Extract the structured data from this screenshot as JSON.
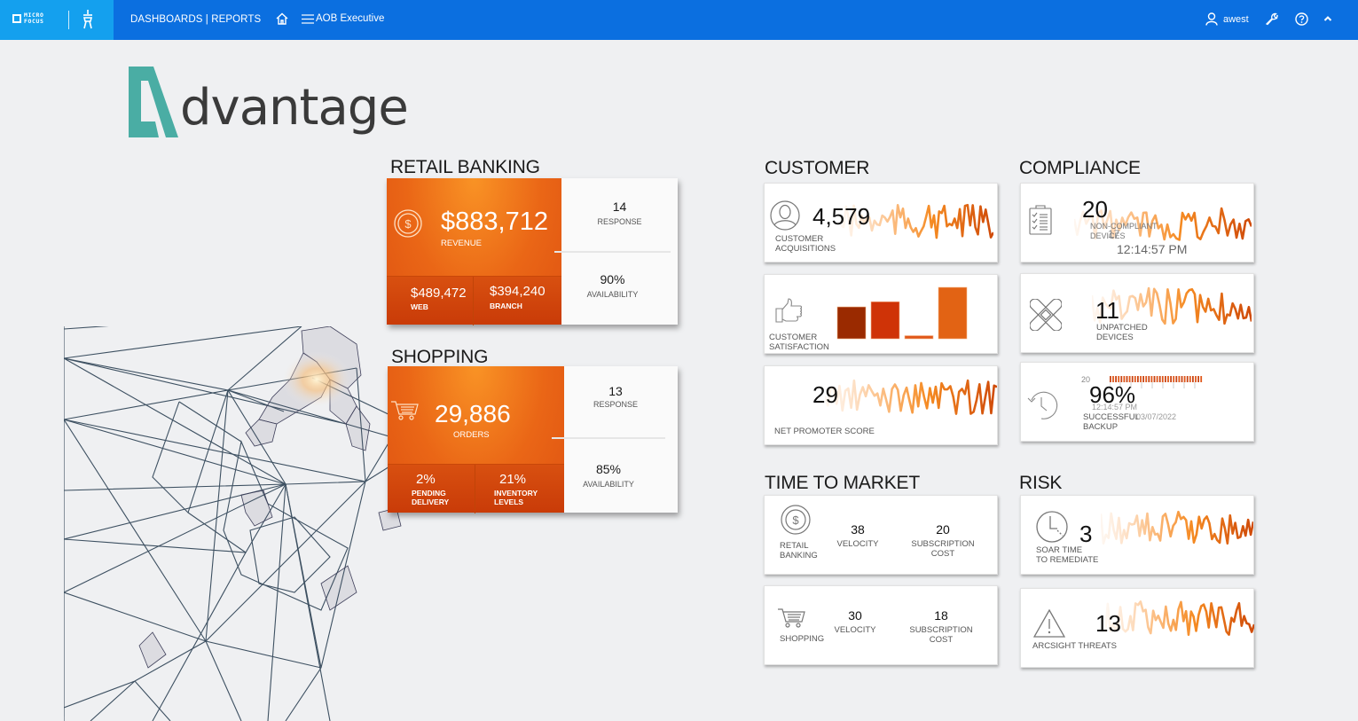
{
  "topbar": {
    "brand": "MICRO FOCUS",
    "brand_line1": "MICRO",
    "brand_line2": "FOCUS",
    "nav_title": "DASHBOARDS | REPORTS",
    "dashboard_name": "AOB Executive",
    "user": "awest",
    "icons": [
      "tower-icon",
      "home-icon",
      "menu-icon",
      "user-icon",
      "wrench-icon",
      "help-icon",
      "chevron-up-icon"
    ]
  },
  "logo": {
    "letter_mark": "A",
    "text": "dvantage",
    "accent_color": "#4aada4"
  },
  "colors": {
    "orange_light": "#f99325",
    "orange": "#ea6616",
    "orange_dark": "#c93b08",
    "topbar": "#0b6fe0",
    "brand_bg": "#14a0ee"
  },
  "retail_banking": {
    "title": "RETAIL BANKING",
    "main": {
      "value": "$883,712",
      "label": "REVENUE",
      "icon": "dollar-coin-icon"
    },
    "subs": [
      {
        "value": "$489,472",
        "label": "WEB"
      },
      {
        "value": "$394,240",
        "label": "BRANCH"
      }
    ],
    "right": [
      {
        "value": "14",
        "label": "RESPONSE"
      },
      {
        "value": "90%",
        "label": "AVAILABILITY"
      }
    ]
  },
  "shopping": {
    "title": "SHOPPING",
    "main": {
      "value": "29,886",
      "label": "ORDERS",
      "icon": "cart-icon"
    },
    "subs": [
      {
        "value": "2%",
        "label1": "PENDING",
        "label2": "DELIVERY"
      },
      {
        "value": "21%",
        "label1": "INVENTORY",
        "label2": "LEVELS"
      }
    ],
    "right": [
      {
        "value": "13",
        "label": "RESPONSE"
      },
      {
        "value": "85%",
        "label": "AVAILABILITY"
      }
    ]
  },
  "customer": {
    "title": "CUSTOMER",
    "acquisitions": {
      "value": "4,579",
      "label1": "CUSTOMER",
      "label2": "ACQUISITIONS"
    },
    "satisfaction": {
      "label1": "CUSTOMER",
      "label2": "SATISFACTION",
      "bars": [
        0.62,
        0.72,
        0.06,
        1.0
      ],
      "bar_colors": [
        "#9a2a00",
        "#cf3307",
        "#e0571a",
        "#e26314"
      ]
    },
    "nps": {
      "value": "29",
      "label": "NET PROMOTER SCORE"
    }
  },
  "compliance": {
    "title": "COMPLIANCE",
    "non_compliant": {
      "value": "20",
      "label1": "NON-COMPLIANT",
      "label2": "DEVICES",
      "overlay_value": "17",
      "time": "12:14:57 PM"
    },
    "unpatched": {
      "value": "11",
      "label1": "UNPATCHED",
      "label2": "DEVICES"
    },
    "backup": {
      "value": "96%",
      "label1": "SUCCESSFUL",
      "label2": "BACKUP",
      "axis_top": "20",
      "overlay_time": "12:14:57 PM",
      "overlay_date": "03/07/2022"
    }
  },
  "time_to_market": {
    "title": "TIME TO MARKET",
    "rows": [
      {
        "label1": "RETAIL",
        "label2": "BANKING",
        "velocity": "38",
        "velocity_label": "VELOCITY",
        "cost": "20",
        "cost_label1": "SUBSCRIPTION",
        "cost_label2": "COST"
      },
      {
        "label1": "SHOPPING",
        "label2": "",
        "velocity": "30",
        "velocity_label": "VELOCITY",
        "cost": "18",
        "cost_label1": "SUBSCRIPTION",
        "cost_label2": "COST"
      }
    ]
  },
  "risk": {
    "title": "RISK",
    "soar": {
      "value": "3",
      "label1": "SOAR TIME",
      "label2": "TO REMEDIATE"
    },
    "arcsight": {
      "value": "13",
      "label": "ARCSIGHT THREATS"
    }
  }
}
